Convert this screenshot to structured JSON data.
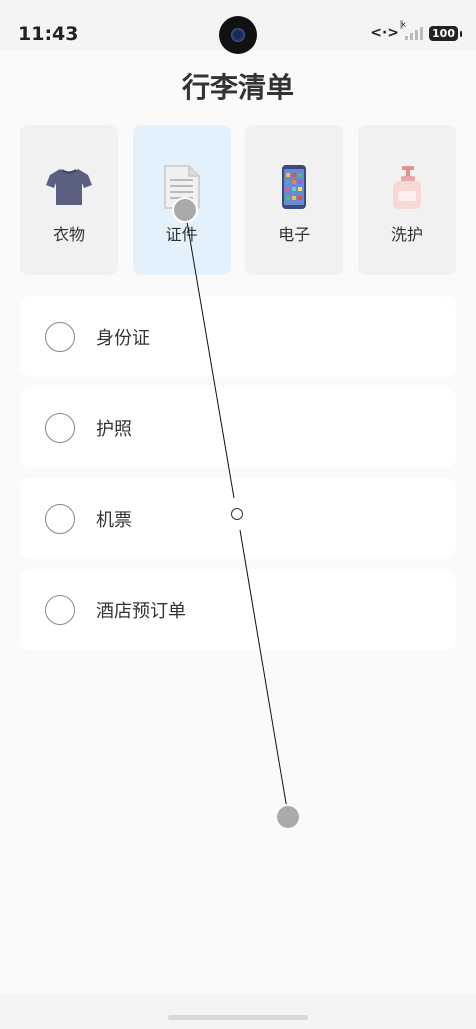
{
  "status_bar": {
    "time": "11:43",
    "battery": "100"
  },
  "header": {
    "title": "行李清单"
  },
  "categories": [
    {
      "label": "衣物",
      "icon": "tshirt-icon",
      "selected": false
    },
    {
      "label": "证件",
      "icon": "document-icon",
      "selected": true
    },
    {
      "label": "电子",
      "icon": "phone-icon",
      "selected": false
    },
    {
      "label": "洗护",
      "icon": "lotion-icon",
      "selected": false
    }
  ],
  "items": [
    {
      "label": "身份证",
      "checked": false
    },
    {
      "label": "护照",
      "checked": false
    },
    {
      "label": "机票",
      "checked": false
    },
    {
      "label": "酒店预订单",
      "checked": false
    }
  ],
  "colors": {
    "selected_card": "#e3f1fd",
    "card": "#f1f1f1",
    "background": "#fafafa"
  }
}
